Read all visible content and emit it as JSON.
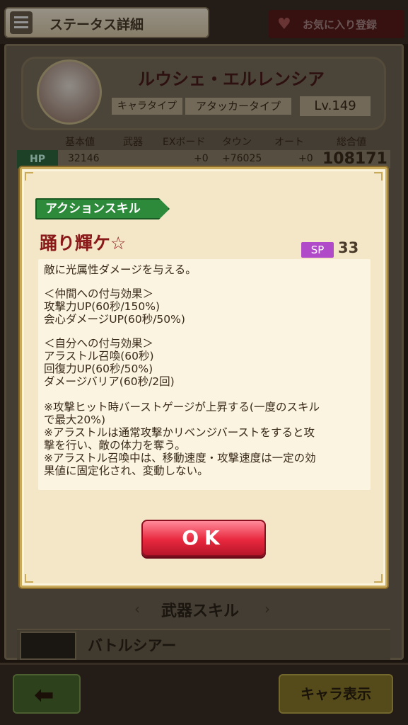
{
  "header": {
    "title": "ステータス詳細",
    "favorite_label": "お気に入り登録"
  },
  "character": {
    "name": "ルウシェ・エルレンシア",
    "type_label": "キャラタイプ",
    "type_value": "アタッカータイプ",
    "level": "Lv.149"
  },
  "stats": {
    "headers": [
      "基本値",
      "武器",
      "EXボード",
      "タウン",
      "オート",
      "総合値"
    ],
    "hp_label": "HP",
    "hp_base": "32146",
    "hp_ex": "+0",
    "hp_town": "+76025",
    "hp_auto": "+0",
    "hp_total": "108171"
  },
  "background_section": {
    "weapon_skill_label": "武器スキル",
    "weapon_name": "バトルシアー"
  },
  "footer": {
    "chara_view_label": "キャラ表示"
  },
  "modal": {
    "skill_tag": "アクションスキル",
    "skill_name": "踊り輝ケ☆",
    "sp_label": "SP",
    "sp_value": "33",
    "description_lines": [
      "敵に光属性ダメージを与える。",
      "＜仲間への付与効果＞",
      "攻撃力UP(60秒/150%)",
      "会心ダメージUP(60秒/50%)",
      "＜自分への付与効果＞",
      "アラストル召喚(60秒)",
      "回復力UP(60秒/50%)",
      "ダメージバリア(60秒/2回)",
      "※攻撃ヒット時バーストゲージが上昇する(一度のスキル",
      "で最大20%)",
      "※アラストルは通常攻撃かリベンジバーストをすると攻",
      "撃を行い、敵の体力を奪う。",
      "※アラストル召喚中は、移動速度・攻撃速度は一定の効",
      "果値に固定化され、変動しない。"
    ],
    "ok_label": "OK"
  },
  "colors": {
    "accent_green": "#2c8a3a",
    "skill_name_red": "#8a1a1a",
    "sp_purple": "#b04ac8",
    "ok_red": "#e8283e"
  }
}
